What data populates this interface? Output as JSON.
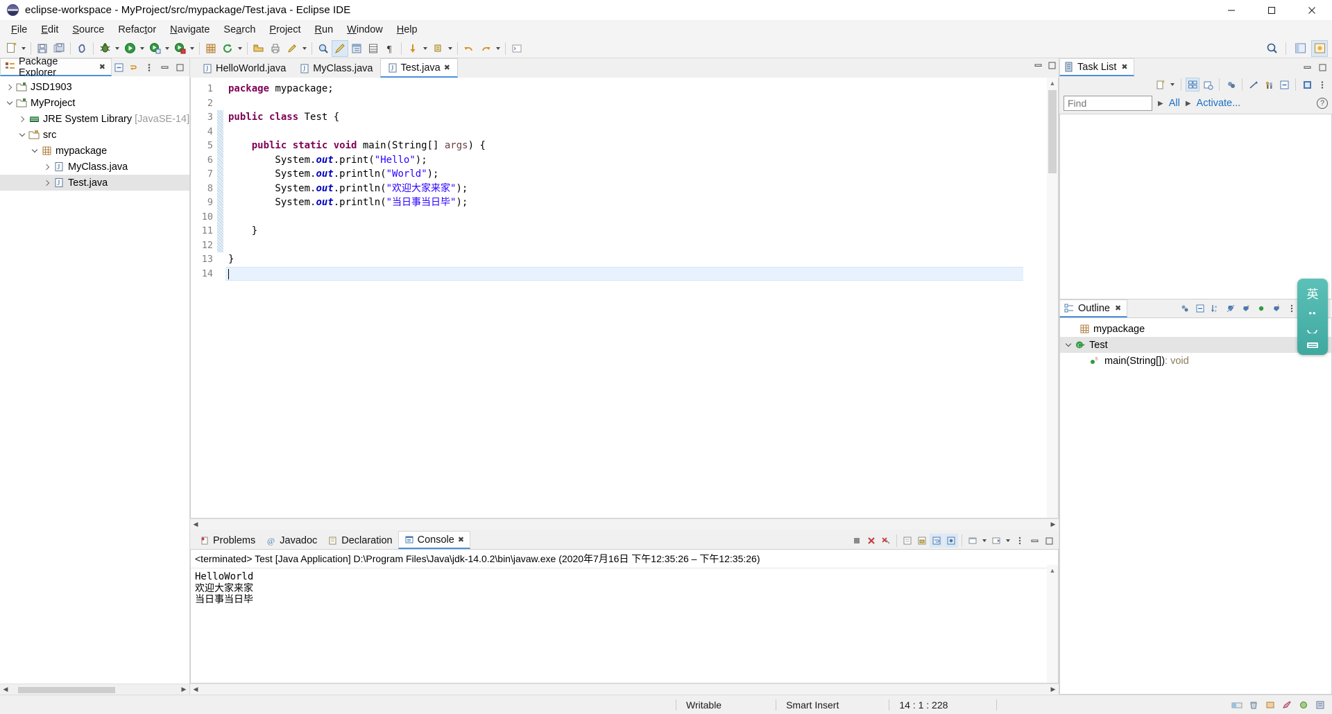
{
  "window": {
    "title": "eclipse-workspace - MyProject/src/mypackage/Test.java - Eclipse IDE",
    "minimize": "─",
    "maximize": "☐",
    "close": "✕"
  },
  "menubar": [
    {
      "label": "File",
      "accel": "F"
    },
    {
      "label": "Edit",
      "accel": "E"
    },
    {
      "label": "Source",
      "accel": "S"
    },
    {
      "label": "Refactor",
      "accel": "t"
    },
    {
      "label": "Navigate",
      "accel": "N"
    },
    {
      "label": "Search",
      "accel": "a"
    },
    {
      "label": "Project",
      "accel": "P"
    },
    {
      "label": "Run",
      "accel": "R"
    },
    {
      "label": "Window",
      "accel": "W"
    },
    {
      "label": "Help",
      "accel": "H"
    }
  ],
  "toolbar": {
    "groups": [
      [
        "new-wizard-icon",
        "new-dropdown"
      ],
      [
        "save-icon",
        "save-all-icon"
      ],
      [
        "link-icon"
      ],
      [
        "debug-icon",
        "debug-dropdown",
        "run-icon",
        "run-dropdown",
        "coverage-icon",
        "coverage-dropdown",
        "profile-icon",
        "profile-dropdown"
      ],
      [
        "new-java-project-icon",
        "refresh-icon",
        "refresh-dropdown"
      ],
      [
        "open-type-icon",
        "print-icon",
        "marker-icon",
        "marker-dropdown"
      ],
      [
        "search-icon",
        "pencil-icon",
        "java-browsing-icon",
        "table-icon",
        "pilcrow-icon"
      ],
      [
        "previous-annotation-icon",
        "previous-dropdown",
        "next-annotation-icon",
        "next-dropdown"
      ],
      [
        "back-icon",
        "forward-icon",
        "forward-dropdown"
      ],
      [
        "terminal-icon"
      ]
    ],
    "right": [
      "search-toolbar-icon",
      "perspective-java-icon",
      "perspective-open-icon"
    ]
  },
  "package_explorer": {
    "tab_label": "Package Explorer",
    "close_glyph": "✖",
    "toolbar_icons": [
      "collapse-all-icon",
      "link-with-editor-icon",
      "view-menu-icon",
      "minimize-icon",
      "maximize-icon"
    ],
    "tree": [
      {
        "label": "JSD1903",
        "icon": "project-closed-icon",
        "indent": 0,
        "twisty": "right",
        "selected": false,
        "suffix": ""
      },
      {
        "label": "MyProject",
        "icon": "project-open-icon",
        "indent": 0,
        "twisty": "down",
        "selected": false,
        "suffix": ""
      },
      {
        "label": "JRE System Library",
        "icon": "jre-library-icon",
        "indent": 1,
        "twisty": "right",
        "selected": false,
        "suffix": "[JavaSE-14]"
      },
      {
        "label": "src",
        "icon": "source-folder-icon",
        "indent": 1,
        "twisty": "down",
        "selected": false,
        "suffix": ""
      },
      {
        "label": "mypackage",
        "icon": "package-icon",
        "indent": 2,
        "twisty": "down",
        "selected": false,
        "suffix": ""
      },
      {
        "label": "MyClass.java",
        "icon": "java-file-icon",
        "indent": 3,
        "twisty": "right",
        "selected": false,
        "suffix": ""
      },
      {
        "label": "Test.java",
        "icon": "java-file-icon",
        "indent": 3,
        "twisty": "right",
        "selected": true,
        "suffix": ""
      }
    ]
  },
  "editor": {
    "tabs": [
      {
        "label": "HelloWorld.java",
        "active": false,
        "closable": false
      },
      {
        "label": "MyClass.java",
        "active": false,
        "closable": false
      },
      {
        "label": "Test.java",
        "active": true,
        "closable": true
      }
    ],
    "close_glyph": "✖",
    "lines": [
      {
        "n": 1,
        "fold": false
      },
      {
        "n": 2,
        "fold": false
      },
      {
        "n": 3,
        "fold": false
      },
      {
        "n": 4,
        "fold": false
      },
      {
        "n": 5,
        "fold": true
      },
      {
        "n": 6,
        "fold": false
      },
      {
        "n": 7,
        "fold": false
      },
      {
        "n": 8,
        "fold": false
      },
      {
        "n": 9,
        "fold": false
      },
      {
        "n": 10,
        "fold": false
      },
      {
        "n": 11,
        "fold": false
      },
      {
        "n": 12,
        "fold": false
      },
      {
        "n": 13,
        "fold": false
      },
      {
        "n": 14,
        "fold": false
      }
    ],
    "code_text": [
      "package mypackage;",
      "",
      "public class Test {",
      "",
      "    public static void main(String[] args) {",
      "        System.out.print(\"Hello\");",
      "        System.out.println(\"World\");",
      "        System.out.println(\"欢迎大家来家\");",
      "        System.out.println(\"当日事当日毕\");",
      "",
      "    }",
      "",
      "}",
      ""
    ],
    "strings": {
      "hello": "Hello",
      "world": "World",
      "welcome_cn": "欢迎大家来家",
      "motto_cn": "当日事当日毕"
    }
  },
  "bottom": {
    "tabs": [
      {
        "label": "Problems",
        "icon": "problems-icon",
        "active": false
      },
      {
        "label": "Javadoc",
        "icon": "javadoc-icon",
        "active": false
      },
      {
        "label": "Declaration",
        "icon": "declaration-icon",
        "active": false
      },
      {
        "label": "Console",
        "icon": "console-icon",
        "active": true
      }
    ],
    "close_glyph": "✖",
    "toolbar_icons": [
      "terminate-icon",
      "remove-launch-icon",
      "remove-all-icon",
      "clear-console-icon",
      "scroll-lock-icon",
      "word-wrap-icon",
      "pin-console-icon",
      "display-selected-icon",
      "open-console-icon",
      "open-dropdown",
      "view-menu-icon",
      "minimize-icon",
      "maximize-icon"
    ],
    "console_header": "<terminated> Test [Java Application] D:\\Program Files\\Java\\jdk-14.0.2\\bin\\javaw.exe  (2020年7月16日 下午12:35:26 – 下午12:35:26)",
    "console_output": [
      "HelloWorld",
      "欢迎大家来家",
      "当日事当日毕"
    ]
  },
  "task_list": {
    "tab_label": "Task List",
    "close_glyph": "✖",
    "toolbar_icons": [
      "new-task-icon",
      "new-task-dropdown",
      "categorized-icon",
      "scheduled-icon",
      "focus-icon",
      "filter-complete-icon",
      "synchronize-icon",
      "collapse-all-icon",
      "restore-icon",
      "view-menu-icon",
      "minimize-icon",
      "maximize-icon"
    ],
    "find_placeholder": "Find",
    "find_value": "",
    "links": [
      "All",
      "Activate..."
    ],
    "help_glyph": "?"
  },
  "outline": {
    "tab_label": "Outline",
    "close_glyph": "✖",
    "toolbar_icons": [
      "focus-icon",
      "collapse-all-icon",
      "sort-icon",
      "hide-fields-icon",
      "hide-static-icon",
      "hide-nonpublic-icon",
      "hide-local-icon",
      "view-menu-icon",
      "minimize-icon",
      "maximize-icon"
    ],
    "tree": [
      {
        "label": "mypackage",
        "icon": "package-icon",
        "indent": 1,
        "twisty": "none",
        "selected": false,
        "suffix": ""
      },
      {
        "label": "Test",
        "icon": "class-icon",
        "indent": 0,
        "twisty": "down",
        "selected": true,
        "suffix": ""
      },
      {
        "label": "main(String[])",
        "icon": "method-public-static-icon",
        "indent": 2,
        "twisty": "none",
        "selected": false,
        "suffix": ": void"
      }
    ]
  },
  "ime_widget": {
    "char": "英",
    "dots": "••",
    "shape_icon": "ime-moon-icon",
    "tray_icon": "ime-keyboard-icon"
  },
  "statusbar": {
    "writable": "Writable",
    "insert_mode": "Smart Insert",
    "position": "14 : 1 : 228",
    "right_icons": [
      "heap-icon",
      "trash-icon",
      "tray-1-icon",
      "tray-2-icon",
      "tray-3-icon",
      "tray-4-icon"
    ]
  },
  "colors": {
    "accent": "#4a90d9",
    "keyword": "#7f0055",
    "string": "#2a00ff",
    "field": "#0000c0",
    "param": "#6a3e3e",
    "link": "#1a6fc4",
    "selection": "#e4e4e4",
    "current_line": "#e8f2fe"
  }
}
